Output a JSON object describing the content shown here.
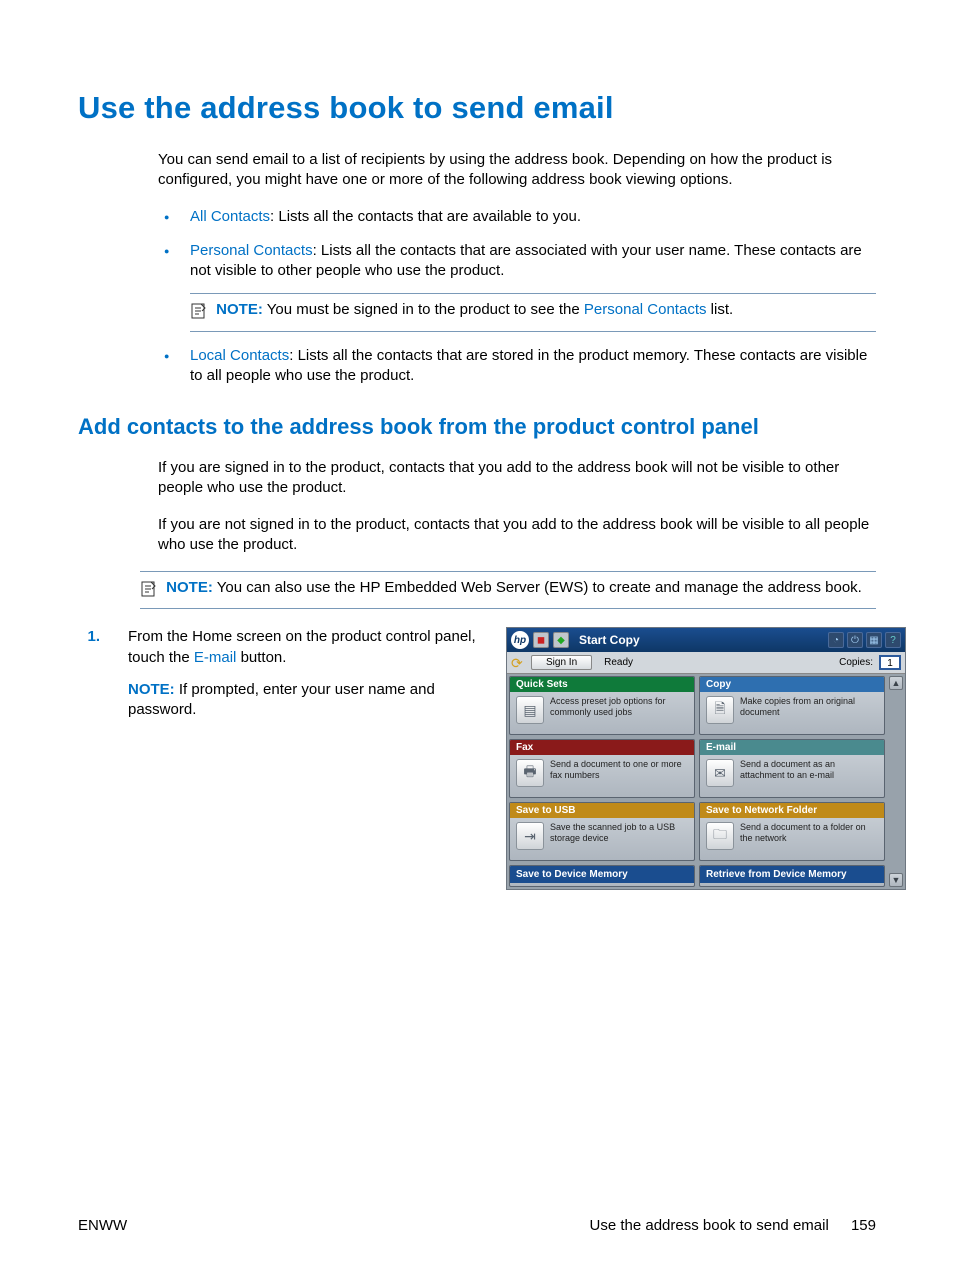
{
  "heading": "Use the address book to send email",
  "intro": "You can send email to a list of recipients by using the address book. Depending on how the product is configured, you might have one or more of the following address book viewing options.",
  "bullets": {
    "b1_link": "All Contacts",
    "b1_rest": ": Lists all the contacts that are available to you.",
    "b2_link": "Personal Contacts",
    "b2_rest": ": Lists all the contacts that are associated with your user name. These contacts are not visible to other people who use the product.",
    "b3_link": "Local Contacts",
    "b3_rest": ": Lists all the contacts that are stored in the product memory. These contacts are visible to all people who use the product."
  },
  "note1": {
    "label": "NOTE:",
    "pre": "You must be signed in to the product to see the ",
    "link": "Personal Contacts",
    "post": " list."
  },
  "subheading": "Add contacts to the address book from the product control panel",
  "para1": "If you are signed in to the product, contacts that you add to the address book will not be visible to other people who use the product.",
  "para2": "If you are not signed in to the product, contacts that you add to the address book will be visible to all people who use the product.",
  "note2": {
    "label": "NOTE:",
    "text": "You can also use the HP Embedded Web Server (EWS) to create and manage the address book."
  },
  "step": {
    "num": "1.",
    "text_pre": "From the Home screen on the product control panel, touch the ",
    "link": "E-mail",
    "text_post": " button.",
    "note_label": "NOTE:",
    "note_text": "If prompted, enter your user name and password."
  },
  "panel": {
    "header_title": "Start Copy",
    "signin": "Sign In",
    "status": "Ready",
    "copies_label": "Copies:",
    "copies_value": "1",
    "tiles": {
      "quicksets": {
        "title": "Quick Sets",
        "desc": "Access preset job options for commonly used jobs"
      },
      "copy": {
        "title": "Copy",
        "desc": "Make copies from an original document"
      },
      "fax": {
        "title": "Fax",
        "desc": "Send a document to one or more fax numbers"
      },
      "email": {
        "title": "E-mail",
        "desc": "Send a document as an attachment to an e-mail"
      },
      "usb": {
        "title": "Save to USB",
        "desc": "Save the scanned job to a USB storage device"
      },
      "network": {
        "title": "Save to Network Folder",
        "desc": "Send a document to a folder on the network"
      },
      "devmem": {
        "title": "Save to Device Memory"
      },
      "retrieve": {
        "title": "Retrieve from Device Memory"
      }
    }
  },
  "footer": {
    "left": "ENWW",
    "right_text": "Use the address book to send email",
    "page": "159"
  }
}
